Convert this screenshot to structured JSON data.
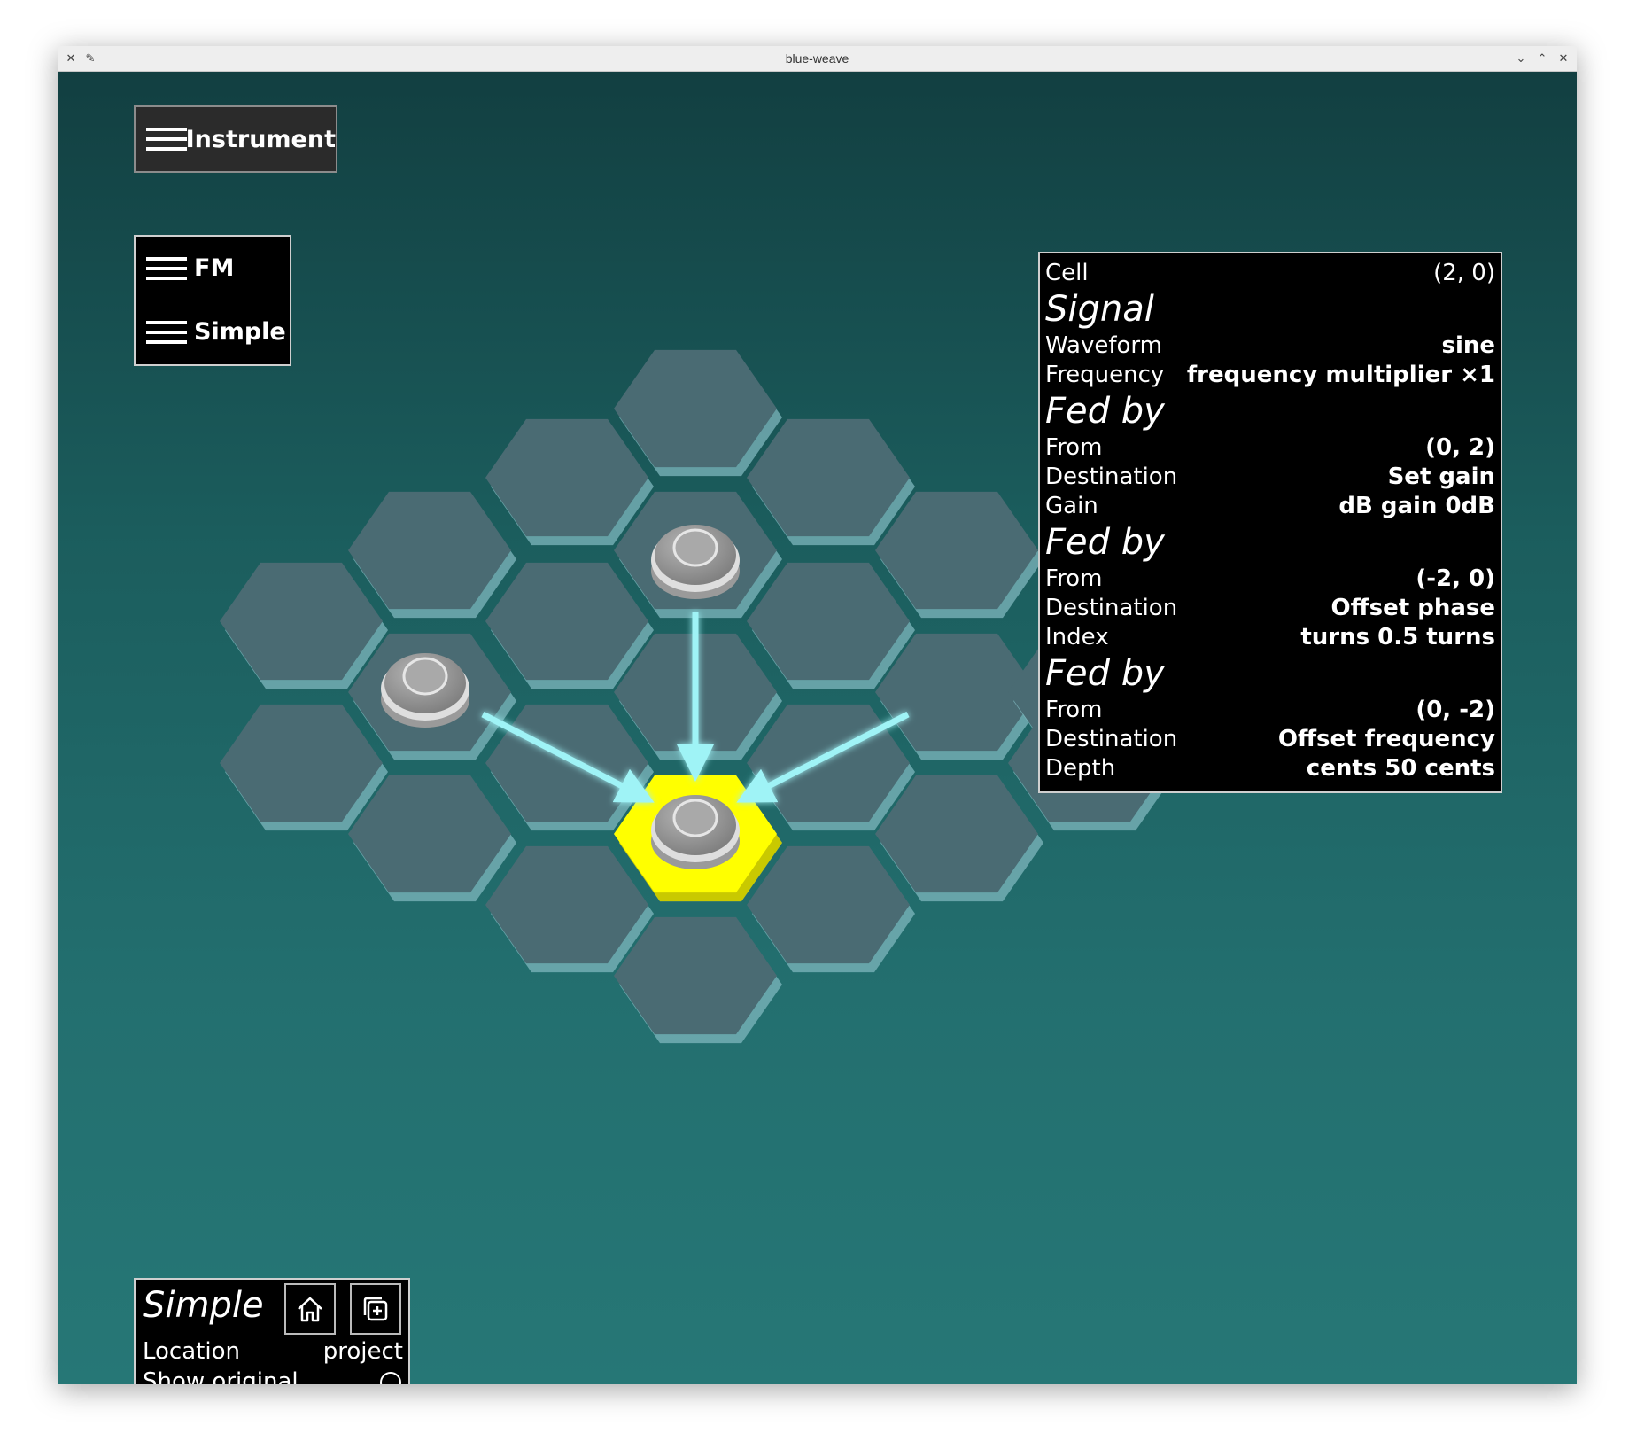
{
  "window": {
    "title": "blue-weave"
  },
  "menus": {
    "instrument": "Instrument",
    "fm": "FM",
    "simple": "Simple"
  },
  "info": {
    "cell": {
      "label": "Cell",
      "value": "(2, 0)"
    },
    "signal": {
      "heading": "Signal",
      "waveform": {
        "label": "Waveform",
        "value": "sine"
      },
      "frequency": {
        "label": "Frequency",
        "value": "frequency multiplier  ×1"
      }
    },
    "fed_by": [
      {
        "heading": "Fed by",
        "from": {
          "label": "From",
          "value": "(0, 2)"
        },
        "destination": {
          "label": "Destination",
          "value": "Set gain"
        },
        "param": {
          "label": "Gain",
          "value": "dB gain  0dB"
        }
      },
      {
        "heading": "Fed by",
        "from": {
          "label": "From",
          "value": "(-2, 0)"
        },
        "destination": {
          "label": "Destination",
          "value": "Offset phase"
        },
        "param": {
          "label": "Index",
          "value": "turns  0.5 turns"
        }
      },
      {
        "heading": "Fed by",
        "from": {
          "label": "From",
          "value": "(0, -2)"
        },
        "destination": {
          "label": "Destination",
          "value": "Offset frequency"
        },
        "param": {
          "label": "Depth",
          "value": "cents  50 cents"
        }
      }
    ]
  },
  "bottom_panel": {
    "title": "Simple",
    "location_label": "Location",
    "location_value": "project",
    "show_original_label": "Show original",
    "show_original_checked": false
  },
  "icons": {
    "window_app": "x-app-icon",
    "pin": "pin-icon",
    "minimize": "chevron-down-icon",
    "maximize": "chevron-up-icon",
    "close": "close-icon",
    "home": "home-icon",
    "duplicate": "duplicate-icon"
  },
  "colors": {
    "selected_cell": "#ffff00",
    "arrow": "#9ff3f6",
    "hex_fill": "#4a6b73",
    "hex_edge": "#7fb7be"
  }
}
